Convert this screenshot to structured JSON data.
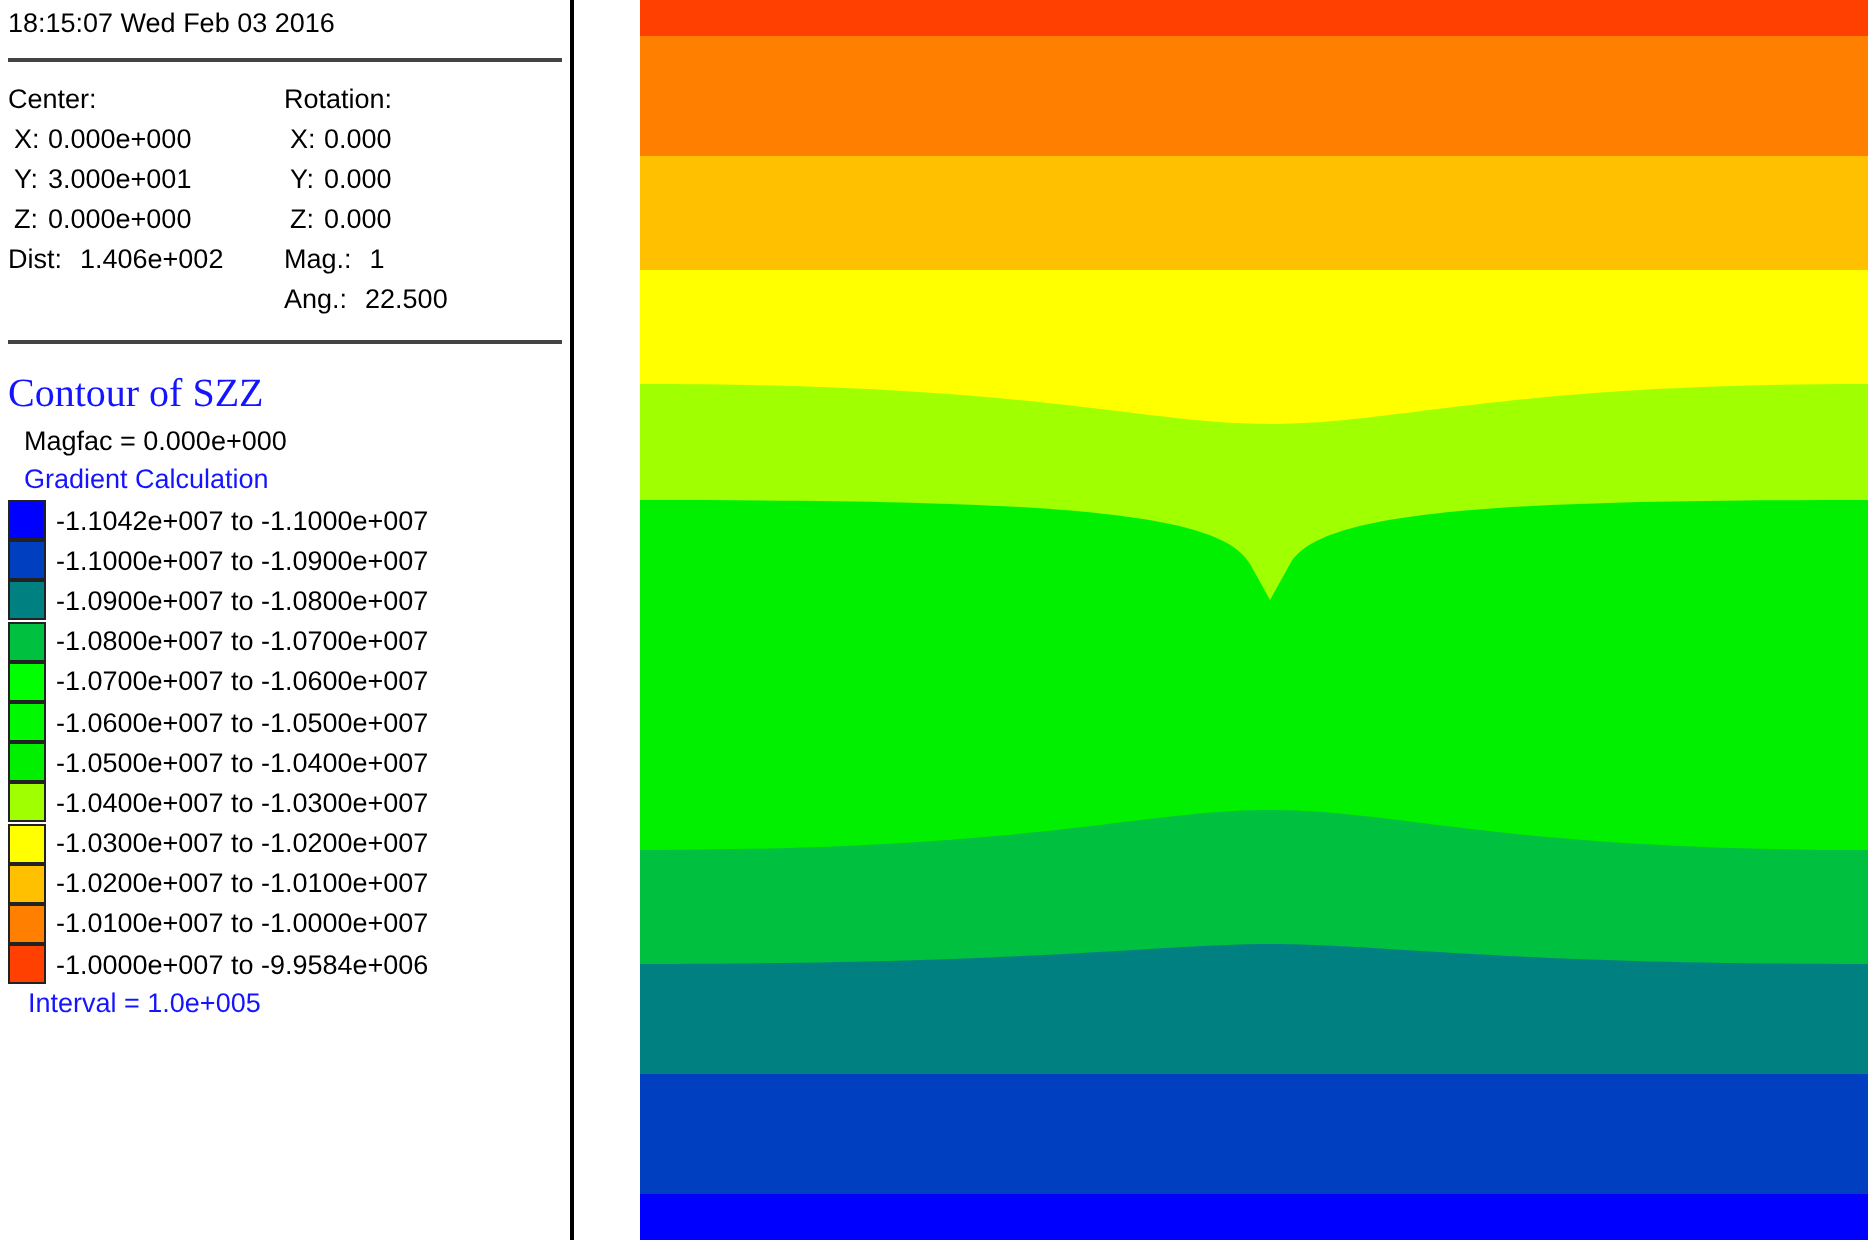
{
  "timestamp": "18:15:07 Wed Feb 03 2016",
  "view": [
    {
      "heading": "Center:",
      "rows": [
        {
          "label": "X:",
          "value": "0.000e+000"
        },
        {
          "label": "Y:",
          "value": "3.000e+001"
        },
        {
          "label": "Z:",
          "value": "0.000e+000"
        },
        {
          "label": "Dist:",
          "value": "1.406e+002"
        }
      ]
    },
    {
      "heading": "Rotation:",
      "rows": [
        {
          "label": "X:",
          "value": "0.000"
        },
        {
          "label": "Y:",
          "value": "0.000"
        },
        {
          "label": "Z:",
          "value": "0.000"
        },
        {
          "label": "Mag.:",
          "value": "1"
        },
        {
          "label": "Ang.:",
          "value": "22.500"
        }
      ]
    }
  ],
  "contour": {
    "title": "Contour of SZZ",
    "magfac": "Magfac =  0.000e+000",
    "method": "Gradient Calculation",
    "interval": "Interval =  1.0e+005",
    "legend": [
      {
        "range": "-1.1042e+007 to -1.1000e+007",
        "color": "#0000ff"
      },
      {
        "range": "-1.1000e+007 to -1.0900e+007",
        "color": "#0040c0"
      },
      {
        "range": "-1.0900e+007 to -1.0800e+007",
        "color": "#008080"
      },
      {
        "range": "-1.0800e+007 to -1.0700e+007",
        "color": "#00c040"
      },
      {
        "range": "-1.0700e+007 to -1.0600e+007",
        "color": "#00ff00"
      },
      {
        "range": "-1.0600e+007 to -1.0500e+007",
        "color": "#00f800"
      },
      {
        "range": "-1.0500e+007 to -1.0400e+007",
        "color": "#00f000"
      },
      {
        "range": "-1.0400e+007 to -1.0300e+007",
        "color": "#a0ff00"
      },
      {
        "range": "-1.0300e+007 to -1.0200e+007",
        "color": "#ffff00"
      },
      {
        "range": "-1.0200e+007 to -1.0100e+007",
        "color": "#ffc000"
      },
      {
        "range": "-1.0100e+007 to -1.0000e+007",
        "color": "#ff8000"
      },
      {
        "range": "-1.0000e+007 to -9.9584e+006",
        "color": "#ff4000"
      }
    ]
  }
}
